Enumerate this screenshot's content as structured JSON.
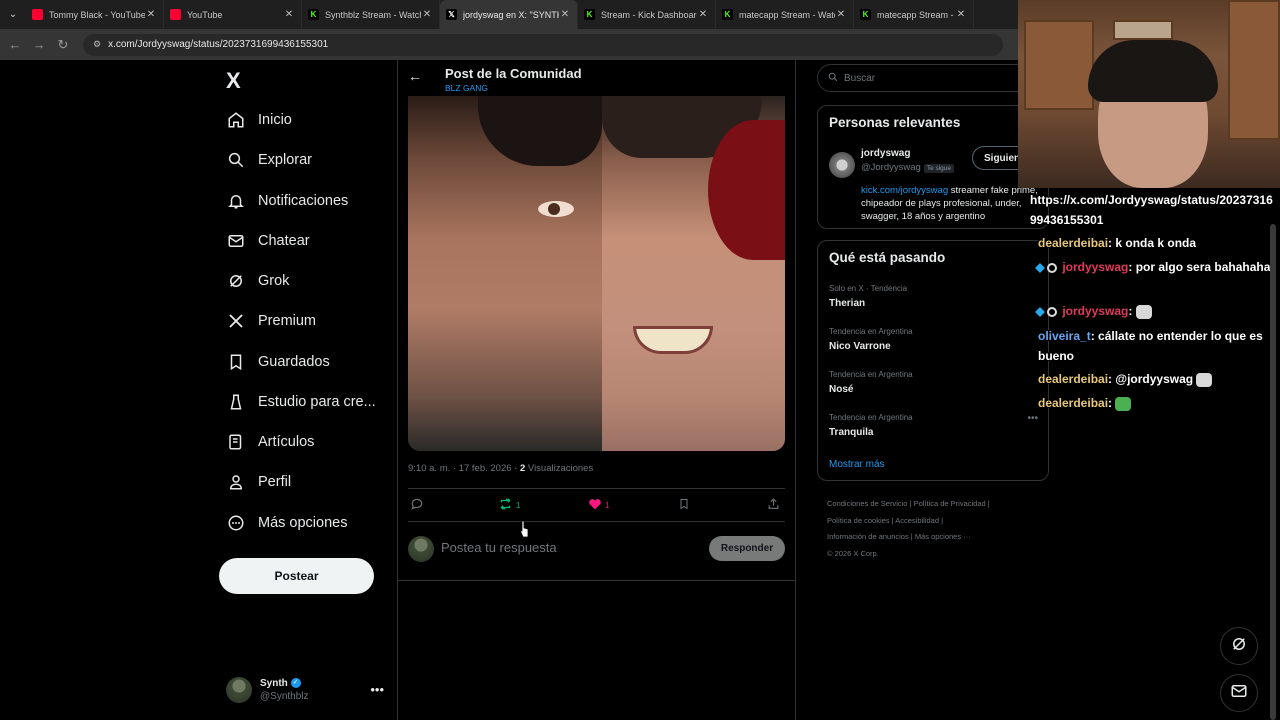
{
  "browser": {
    "tabs": [
      {
        "title": "Tommy Black - YouTube",
        "favicon": "youtube-icon"
      },
      {
        "title": "YouTube",
        "favicon": "youtube-icon"
      },
      {
        "title": "Synthblz Stream - Watch",
        "favicon": "kick-icon"
      },
      {
        "title": "jordyswag en X: \"SYNTHB",
        "favicon": "x-icon",
        "active": true
      },
      {
        "title": "Stream - Kick Dashboard",
        "favicon": "kick-icon"
      },
      {
        "title": "matecapp Stream - Watch",
        "favicon": "kick-icon"
      },
      {
        "title": "matecapp Stream - Watch",
        "favicon": "kick-icon"
      }
    ],
    "url": "x.com/Jordyyswag/status/2023731699436155301"
  },
  "leftnav": {
    "logo": "X",
    "items": [
      "Inicio",
      "Explorar",
      "Notificaciones",
      "Chatear",
      "Grok",
      "Premium",
      "Guardados",
      "Estudio para cre...",
      "Artículos",
      "Perfil",
      "Más opciones"
    ],
    "post_label": "Postear",
    "account": {
      "name": "Synth",
      "handle": "@Synthblz"
    }
  },
  "post": {
    "title": "Post de la Comunidad",
    "community": "BLZ GANG",
    "time": "9:10 a. m. · 17 feb. 2026 · ",
    "views_count": "2",
    "views_label": " Visualizaciones",
    "reposts": "1",
    "likes": "1",
    "reply_placeholder": "Postea tu respuesta",
    "reply_button": "Responder"
  },
  "right": {
    "search_placeholder": "Buscar",
    "relevant": {
      "heading": "Personas relevantes",
      "name": "jordyswag",
      "handle": "@Jordyyswag",
      "badge": "Te sigue",
      "follow_label": "Siguiendo",
      "bio_link": "kick.com/jordyyswag",
      "bio_text": " streamer fake prime, chipeador de plays profesional, under, swagger, 18 años y argentino"
    },
    "trends": {
      "heading": "Qué está pasando",
      "items": [
        {
          "context": "Solo en X · Tendencia",
          "name": "Therian"
        },
        {
          "context": "Tendencia en Argentina",
          "name": "Nico Varrone"
        },
        {
          "context": "Tendencia en Argentina",
          "name": "Nosé"
        },
        {
          "context": "Tendencia en Argentina",
          "name": "Tranquila"
        }
      ],
      "show_more": "Mostrar más"
    },
    "footer": {
      "line1": "Condiciones de Servicio  |  Política de Privacidad  |",
      "line2": "Política de cookies  |  Accesibilidad  |",
      "line3": "Información de anuncios  |  Más opciones ···",
      "line4": "© 2026 X Corp."
    }
  },
  "chat": {
    "messages": [
      {
        "user": "",
        "text": "https://x.com/Jordyyswag/status/2023731699436155301"
      },
      {
        "user": "dealerdeibai",
        "text": ": k onda k onda"
      },
      {
        "user": "jordyyswag",
        "text": ": por algo sera bahahaha"
      },
      {
        "user": "jordyyswag",
        "text": ":"
      },
      {
        "user": "oliveira_t",
        "text": ": cállate no entender lo que es bueno"
      },
      {
        "user": "dealerdeibai",
        "text": ": @jordyyswag"
      },
      {
        "user": "dealerdeibai",
        "text": ":"
      }
    ]
  },
  "colors": {
    "accent": "#1d9bf0",
    "like": "#f91880",
    "repost": "#00ba7c",
    "background": "#000000"
  }
}
